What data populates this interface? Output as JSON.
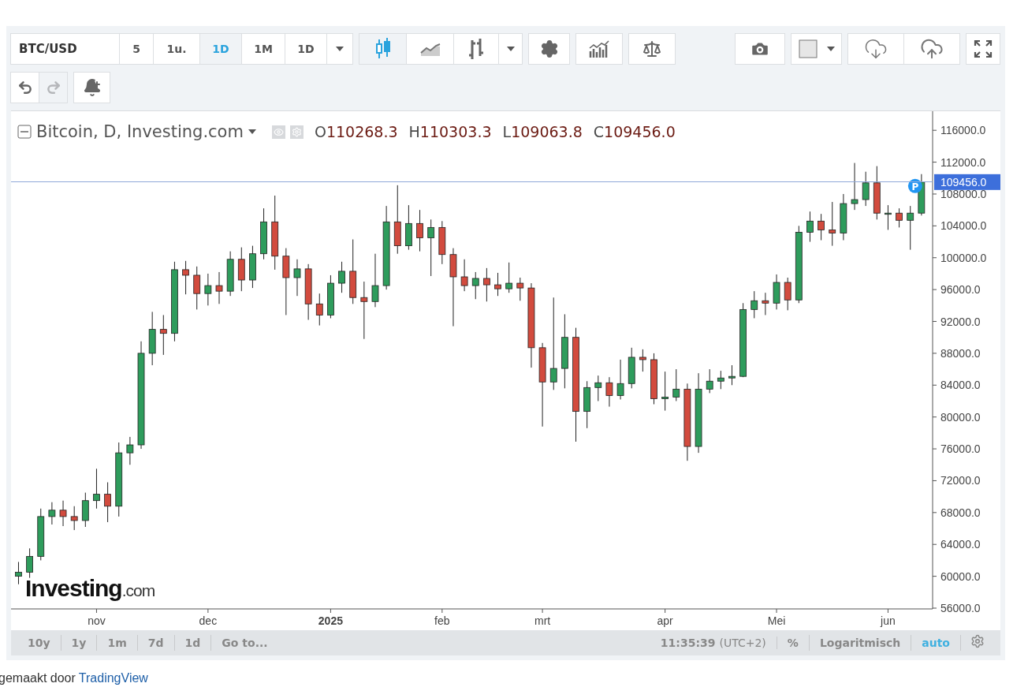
{
  "toolbar": {
    "symbol": "BTC/USD",
    "intervals": [
      {
        "label": "5",
        "selected": false
      },
      {
        "label": "1u.",
        "selected": false
      },
      {
        "label": "1D",
        "selected": true
      },
      {
        "label": "1M",
        "selected": false
      },
      {
        "label": "1D",
        "selected": false
      }
    ],
    "chart_styles": [
      {
        "kind": "candles",
        "selected": true
      },
      {
        "kind": "area",
        "selected": false
      },
      {
        "kind": "bars",
        "selected": false
      }
    ]
  },
  "history": {
    "undo_disabled": false,
    "redo_disabled": true
  },
  "legend": {
    "title": "Bitcoin, D, Investing.com",
    "values": [
      {
        "label": "O",
        "value": "110268.3"
      },
      {
        "label": "H",
        "value": "110303.3"
      },
      {
        "label": "L",
        "value": "109063.8"
      },
      {
        "label": "C",
        "value": "109456.0"
      }
    ]
  },
  "chart": {
    "logo": {
      "main": "Investing",
      "suffix": ".com"
    },
    "marker": "P",
    "last_price": "109456.0",
    "chart_data": {
      "type": "candlestick",
      "ylim": [
        56000,
        118100
      ],
      "categories": [
        null,
        null,
        null,
        null,
        null,
        null,
        null,
        "nov",
        null,
        null,
        null,
        null,
        null,
        null,
        null,
        null,
        null,
        "dec",
        null,
        null,
        null,
        null,
        null,
        null,
        null,
        null,
        null,
        null,
        "**2025**",
        null,
        null,
        null,
        null,
        null,
        null,
        null,
        null,
        null,
        "feb",
        null,
        null,
        null,
        null,
        null,
        null,
        null,
        null,
        "mrt",
        null,
        null,
        null,
        null,
        null,
        null,
        null,
        null,
        null,
        null,
        "apr",
        null,
        null,
        null,
        null,
        null,
        null,
        null,
        null,
        null,
        "Mei",
        null,
        null,
        null,
        null,
        null,
        null,
        null,
        null,
        null,
        "jun",
        null,
        null,
        null
      ],
      "yticks": [
        {
          "value": 56000,
          "label": "56000.0"
        },
        {
          "value": 60000,
          "label": "60000.0"
        },
        {
          "value": 64000,
          "label": "64000.0"
        },
        {
          "value": 68000,
          "label": "68000.0"
        },
        {
          "value": 72000,
          "label": "72000.0"
        },
        {
          "value": 76000,
          "label": "76000.0"
        },
        {
          "value": 80000,
          "label": "80000.0"
        },
        {
          "value": 84000,
          "label": "84000.0"
        },
        {
          "value": 88000,
          "label": "88000.0"
        },
        {
          "value": 92000,
          "label": "92000.0"
        },
        {
          "value": 96000,
          "label": "96000.0"
        },
        {
          "value": 100000,
          "label": "100000.0"
        },
        {
          "value": 104000,
          "label": "104000.0"
        },
        {
          "value": 108000,
          "label": "108000.0"
        },
        {
          "value": 112000,
          "label": "112000.0"
        },
        {
          "value": 116000,
          "label": "116000.0"
        }
      ],
      "ohlc": [
        [
          60000,
          61800,
          59000,
          60500
        ],
        [
          60500,
          63500,
          59800,
          62500
        ],
        [
          62500,
          68500,
          62000,
          67500
        ],
        [
          67500,
          69300,
          66500,
          68300
        ],
        [
          68300,
          69500,
          66300,
          67500
        ],
        [
          67500,
          68800,
          65800,
          67000
        ],
        [
          67000,
          70500,
          66200,
          69500
        ],
        [
          69500,
          73500,
          68500,
          70300
        ],
        [
          70300,
          71800,
          66800,
          68800
        ],
        [
          68800,
          76800,
          67500,
          75500
        ],
        [
          75500,
          77500,
          74000,
          76500
        ],
        [
          76500,
          89500,
          76000,
          88000
        ],
        [
          88000,
          93200,
          86500,
          91000
        ],
        [
          91000,
          92800,
          87800,
          90500
        ],
        [
          90500,
          99500,
          89500,
          98500
        ],
        [
          98500,
          99600,
          95400,
          97800
        ],
        [
          97800,
          98900,
          93500,
          95500
        ],
        [
          95500,
          98000,
          94000,
          96500
        ],
        [
          96500,
          98200,
          94200,
          95800
        ],
        [
          95800,
          100800,
          95200,
          99800
        ],
        [
          99800,
          101300,
          95800,
          97200
        ],
        [
          97200,
          101500,
          96200,
          100500
        ],
        [
          100500,
          106200,
          99800,
          104500
        ],
        [
          104500,
          107800,
          98500,
          100200
        ],
        [
          100200,
          101200,
          92800,
          97500
        ],
        [
          97500,
          99800,
          95200,
          98600
        ],
        [
          98600,
          99200,
          92200,
          94200
        ],
        [
          94200,
          95500,
          91500,
          92800
        ],
        [
          92800,
          97800,
          92400,
          96800
        ],
        [
          96800,
          99500,
          95600,
          98300
        ],
        [
          98300,
          102300,
          94200,
          95000
        ],
        [
          95000,
          97000,
          89800,
          94500
        ],
        [
          94500,
          100500,
          93800,
          96500
        ],
        [
          96500,
          106500,
          96000,
          104500
        ],
        [
          104500,
          109100,
          100500,
          101500
        ],
        [
          101500,
          106600,
          101000,
          104300
        ],
        [
          104300,
          106000,
          100800,
          102500
        ],
        [
          102500,
          104800,
          97700,
          103800
        ],
        [
          103800,
          104600,
          99200,
          100400
        ],
        [
          100400,
          101200,
          91400,
          97600
        ],
        [
          97600,
          99800,
          95800,
          96500
        ],
        [
          96500,
          98200,
          94800,
          97400
        ],
        [
          97400,
          98700,
          94500,
          96600
        ],
        [
          96600,
          98100,
          95200,
          96100
        ],
        [
          96100,
          99400,
          95600,
          96800
        ],
        [
          96800,
          97500,
          94600,
          96200
        ],
        [
          96200,
          96800,
          86200,
          88700
        ],
        [
          88700,
          89300,
          78800,
          84400
        ],
        [
          84400,
          95000,
          83400,
          86100
        ],
        [
          86100,
          92900,
          83600,
          90000
        ],
        [
          90000,
          91200,
          76900,
          80700
        ],
        [
          80700,
          84500,
          78600,
          83700
        ],
        [
          83700,
          85200,
          82000,
          84300
        ],
        [
          84300,
          85000,
          81300,
          82700
        ],
        [
          82700,
          87200,
          82200,
          84200
        ],
        [
          84200,
          88700,
          83600,
          87500
        ],
        [
          87500,
          88500,
          85700,
          87200
        ],
        [
          87200,
          88000,
          81600,
          82300
        ],
        [
          82300,
          85700,
          80800,
          82500
        ],
        [
          82500,
          86000,
          82000,
          83500
        ],
        [
          83500,
          84200,
          74500,
          76300
        ],
        [
          76300,
          85500,
          75500,
          83500
        ],
        [
          83500,
          86000,
          83000,
          84500
        ],
        [
          84500,
          85800,
          83500,
          84900
        ],
        [
          84900,
          86500,
          84000,
          85100
        ],
        [
          85100,
          94300,
          85000,
          93500
        ],
        [
          93500,
          95800,
          92400,
          94600
        ],
        [
          94600,
          95600,
          92800,
          94300
        ],
        [
          94300,
          97900,
          93500,
          96900
        ],
        [
          96900,
          97500,
          93400,
          94700
        ],
        [
          94700,
          104000,
          94300,
          103200
        ],
        [
          103200,
          105800,
          102000,
          104600
        ],
        [
          104600,
          105500,
          102200,
          103500
        ],
        [
          103500,
          107000,
          101500,
          103100
        ],
        [
          103100,
          108000,
          102200,
          106800
        ],
        [
          106800,
          111900,
          106000,
          107300
        ],
        [
          107300,
          110800,
          106500,
          109400
        ],
        [
          109400,
          111500,
          104800,
          105600
        ],
        [
          105600,
          106600,
          103500,
          105600
        ],
        [
          105600,
          106200,
          103800,
          104700
        ],
        [
          104700,
          106500,
          101000,
          105600
        ],
        [
          105600,
          110500,
          105300,
          109500
        ]
      ]
    }
  },
  "ranges": [
    "10y",
    "1y",
    "1m",
    "7d",
    "1d",
    "Go to..."
  ],
  "status": {
    "time": "11:35:39",
    "timezone": "(UTC+2)",
    "percent": {
      "label": "%",
      "selected": false
    },
    "log": {
      "label": "Logaritmisch",
      "selected": false
    },
    "auto": {
      "label": "auto",
      "selected": true
    }
  },
  "credit": {
    "text": "gemaakt door",
    "link": "TradingView"
  }
}
